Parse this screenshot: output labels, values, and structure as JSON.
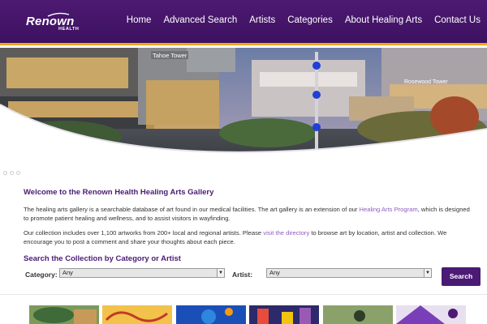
{
  "header": {
    "logo_text": "Renown",
    "logo_sub": "HEALTH",
    "nav": [
      "Home",
      "Advanced Search",
      "Artists",
      "Categories",
      "About Healing Arts",
      "Contact Us"
    ]
  },
  "hero": {
    "building_signs": [
      "Tahoe Tower",
      "Rosewood Tower"
    ],
    "slides": 3
  },
  "main": {
    "welcome_title": "Welcome to the Renown Health Healing Arts Gallery",
    "para1_a": "The healing arts gallery is a searchable database of art found in our medical facilities. The art gallery is an extension of our ",
    "para1_link": "Healing Arts Program",
    "para1_b": ", which is designed to promote patient healing and wellness, and to assist visitors in wayfinding.",
    "para2_a": "Our collection includes over 1,100 artworks from 200+ local and regional artists. Please ",
    "para2_link": "visit the directory",
    "para2_b": " to browse art by location, artist and collection. We encourage you to post a comment and share your thoughts about each piece.",
    "search_title": "Search the Collection by Category or Artist"
  },
  "search": {
    "category_label": "Category:",
    "category_value": "Any",
    "artist_label": "Artist:",
    "artist_value": "Any",
    "button_label": "Search"
  },
  "colors": {
    "brand_purple": "#4b1a74",
    "accent_gold": "#f0a91c",
    "link_purple": "#8f5cc0"
  }
}
